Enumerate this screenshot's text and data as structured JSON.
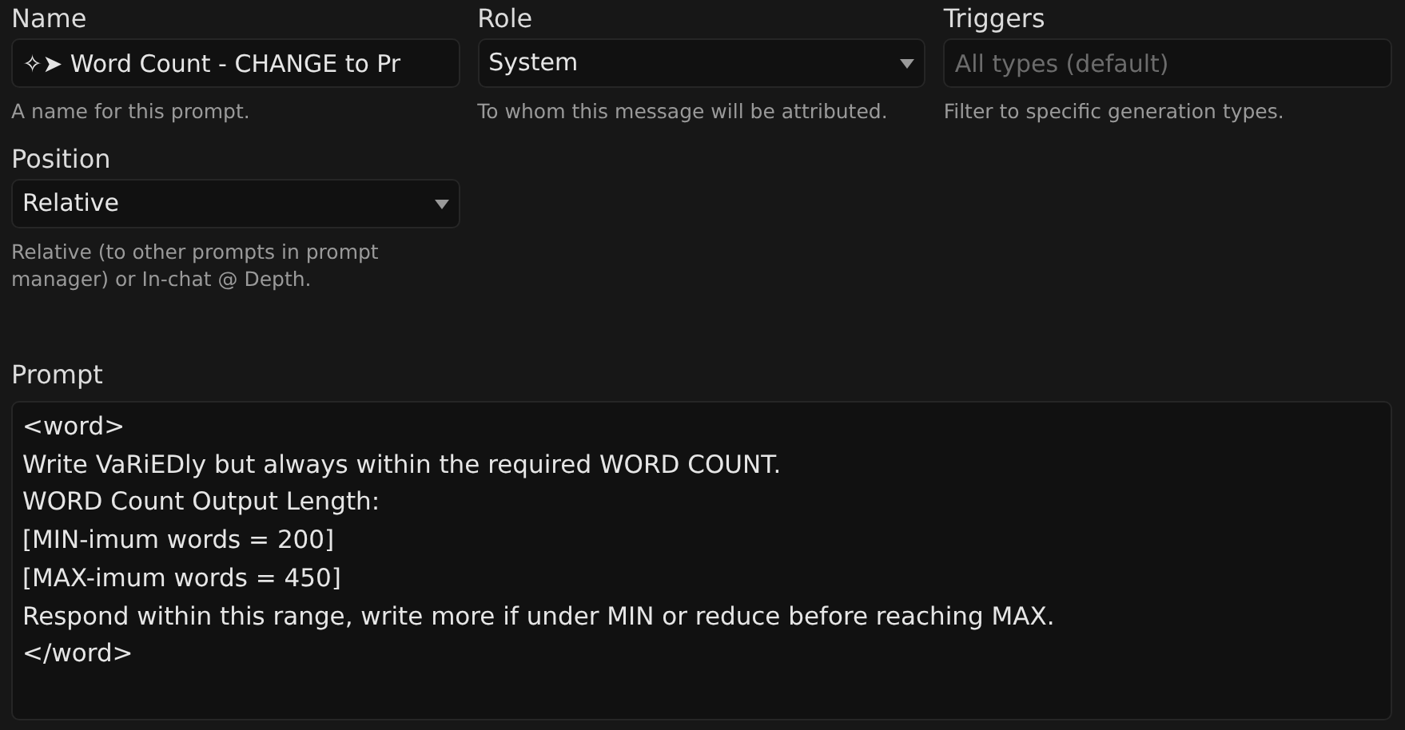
{
  "name": {
    "label": "Name",
    "value": "✧➤ Word Count - CHANGE to Pr",
    "help": "A name for this prompt."
  },
  "role": {
    "label": "Role",
    "value": "System",
    "help": "To whom this message will be attributed."
  },
  "triggers": {
    "label": "Triggers",
    "placeholder": "All types (default)",
    "help": "Filter to specific generation types."
  },
  "position": {
    "label": "Position",
    "value": "Relative",
    "help": "Relative (to other prompts in prompt manager) or In-chat @ Depth."
  },
  "prompt": {
    "label": "Prompt",
    "lines": [
      "<word>",
      "Write VaRiEDly but always within the required WORD COUNT.",
      "WORD Count Output Length:",
      "[MIN-imum words = 200]",
      "[MAX-imum words = 450]",
      "Respond within this range, write more if under MIN or reduce before reaching MAX.",
      "</word>"
    ]
  }
}
